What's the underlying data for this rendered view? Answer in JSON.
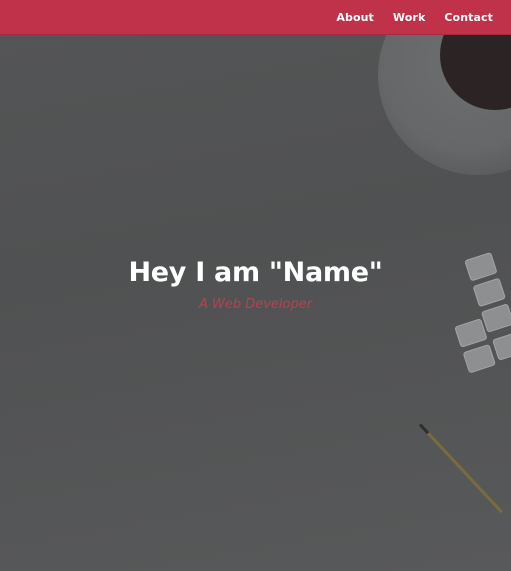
{
  "navbar": {
    "links": [
      "About",
      "Work",
      "Contact"
    ]
  },
  "hero": {
    "title": "Hey I am \"Name\"",
    "subtitle": "A Web Developer"
  },
  "colors": {
    "navbar_background": "#c0314a",
    "hero_overlay": "#555657",
    "subtitle_color": "#b8414f"
  }
}
